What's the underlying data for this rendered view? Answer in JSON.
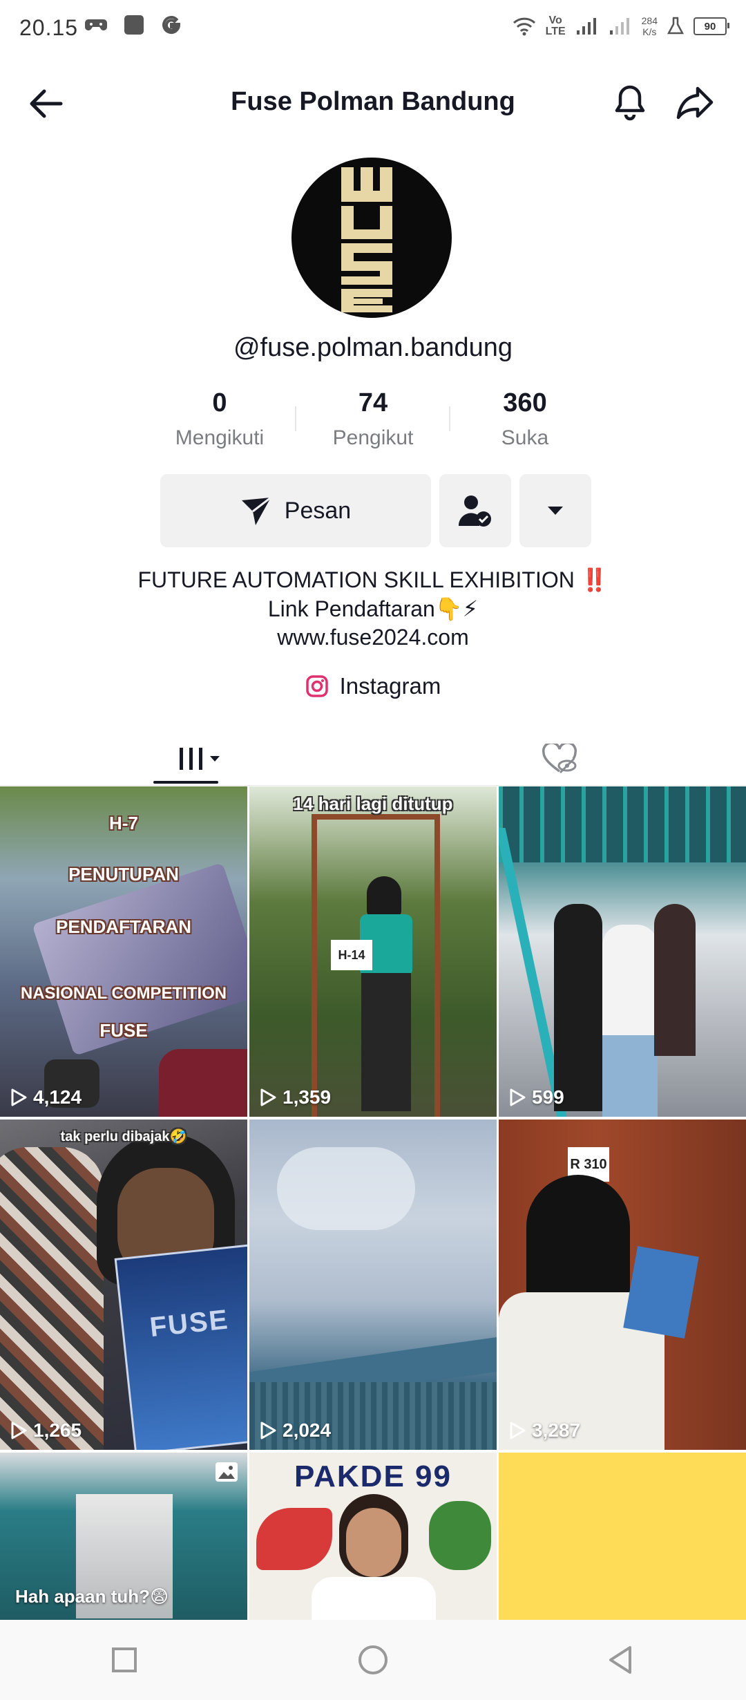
{
  "status_bar": {
    "time": "20.15",
    "network_speed_value": "284",
    "network_speed_unit": "K/s",
    "volte_top": "Vo",
    "volte_bottom": "LTE",
    "battery": "90",
    "left_icons": [
      "game-controller-icon",
      "square-app-icon",
      "google-g-icon"
    ],
    "right_icons": [
      "wifi-icon",
      "signal-icon",
      "signal-weak-icon",
      "flask-icon",
      "battery-icon"
    ]
  },
  "header": {
    "title": "Fuse Polman Bandung",
    "icons": [
      "back-arrow-icon",
      "bell-icon",
      "share-icon"
    ]
  },
  "profile": {
    "username": "@fuse.polman.bandung",
    "stats": [
      {
        "value": "0",
        "label": "Mengikuti"
      },
      {
        "value": "74",
        "label": "Pengikut"
      },
      {
        "value": "360",
        "label": "Suka"
      }
    ],
    "message_button": "Pesan",
    "bio_lines": [
      "FUTURE AUTOMATION SKILL EXHIBITION ‼️",
      "Link Pendaftaran👇⚡",
      "www.fuse2024.com"
    ],
    "instagram_label": "Instagram",
    "accent_color": "#fe2c55"
  },
  "tabs": [
    "videos-grid-icon",
    "liked-hidden-icon"
  ],
  "videos": [
    {
      "views": "4,124",
      "captions": [
        "H-7",
        "PENUTUPAN",
        "PENDAFTARAN",
        "NASIONAL COMPETITION",
        "FUSE"
      ]
    },
    {
      "views": "1,359",
      "captions": [
        "14 hari lagi ditutup"
      ],
      "sign": "H-14"
    },
    {
      "views": "599",
      "captions": []
    },
    {
      "views": "1,265",
      "captions": [
        "tak perlu dibajak🤣"
      ],
      "poster_text": "FUSE"
    },
    {
      "views": "2,024",
      "captions": []
    },
    {
      "views": "3,287",
      "captions": [],
      "door_sign": "R 310"
    },
    {
      "views": "",
      "captions": [
        "Hah apaan tuh?😨"
      ]
    },
    {
      "views": "",
      "captions": [],
      "banner_text": "PAKDE 99"
    },
    {
      "views": "",
      "captions": []
    }
  ],
  "nav_bar": [
    "recents-square-icon",
    "home-circle-icon",
    "back-triangle-icon"
  ]
}
